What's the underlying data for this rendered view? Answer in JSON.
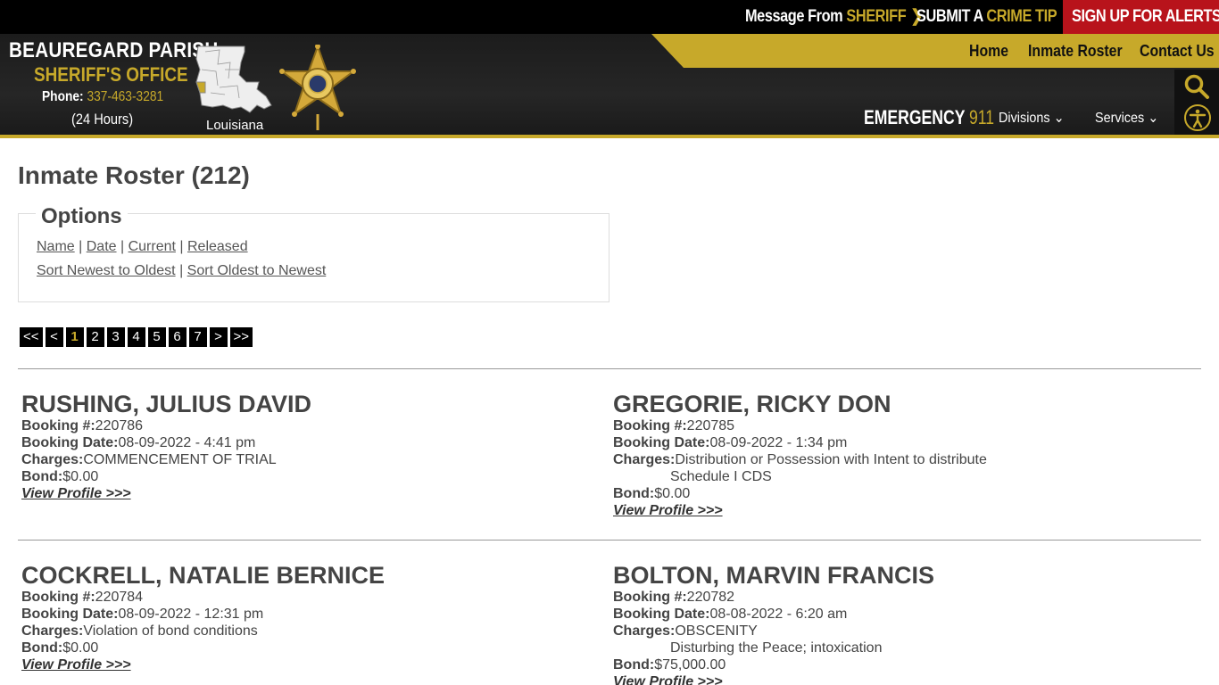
{
  "topbar": {
    "message_prefix": "Message From ",
    "message_highlight": "SHERIFF",
    "crime_prefix": "SUBMIT A ",
    "crime_highlight": "CRIME TIP",
    "alerts": "SIGN UP FOR ALERTS",
    "chevron": "❯"
  },
  "brand": {
    "line1": "BEAUREGARD PARISH",
    "line2": "SHERIFF'S OFFICE",
    "phone_label": "Phone: ",
    "phone_number": "337-463-3281",
    "hours": "(24 Hours)",
    "state_label": "Louisiana"
  },
  "nav": {
    "home": "Home",
    "inmate_roster": "Inmate Roster",
    "contact_us": "Contact Us",
    "emergency_label": "EMERGENCY ",
    "emergency_number": "911",
    "divisions": "Divisions",
    "services": "Services",
    "caret": "⌄"
  },
  "colors": {
    "gold": "#c7a92a",
    "alert_red": "#b8131b",
    "header_dark": "#1c1c1c"
  },
  "icons": {
    "search": "search-icon",
    "accessibility": "accessibility-icon",
    "badge": "sheriff-star-badge",
    "map": "louisiana-map"
  },
  "page": {
    "title": "Inmate Roster (212)"
  },
  "options": {
    "legend": "Options",
    "filters": [
      "Name",
      "Date",
      "Current",
      "Released"
    ],
    "sort_newest": "Sort Newest to Oldest",
    "sort_oldest": "Sort Oldest to Newest",
    "separator": " | "
  },
  "pagination": {
    "first": "<<",
    "prev": "<",
    "pages": [
      "1",
      "2",
      "3",
      "4",
      "5",
      "6",
      "7"
    ],
    "current": "1",
    "next": ">",
    "last": ">>"
  },
  "labels": {
    "booking_no": "Booking #:",
    "booking_date": "Booking Date:",
    "charges": "Charges:",
    "bond": "Bond:",
    "view_profile": "View Profile >>>"
  },
  "inmates": [
    {
      "name": "RUSHING, JULIUS DAVID",
      "booking": "220786",
      "date": "08-09-2022 - 4:41 pm",
      "charges": [
        "COMMENCEMENT OF TRIAL"
      ],
      "bond": "$0.00"
    },
    {
      "name": "GREGORIE, RICKY DON",
      "booking": "220785",
      "date": "08-09-2022 - 1:34 pm",
      "charges": [
        "Distribution or Possession with Intent to distribute",
        "Schedule I CDS"
      ],
      "bond": "$0.00"
    },
    {
      "name": "COCKRELL, NATALIE BERNICE",
      "booking": "220784",
      "date": "08-09-2022 - 12:31 pm",
      "charges": [
        "Violation of bond conditions"
      ],
      "bond": "$0.00"
    },
    {
      "name": "BOLTON, MARVIN FRANCIS",
      "booking": "220782",
      "date": "08-08-2022 - 6:20 am",
      "charges": [
        "OBSCENITY",
        "Disturbing the Peace; intoxication"
      ],
      "bond": "$75,000.00"
    }
  ]
}
